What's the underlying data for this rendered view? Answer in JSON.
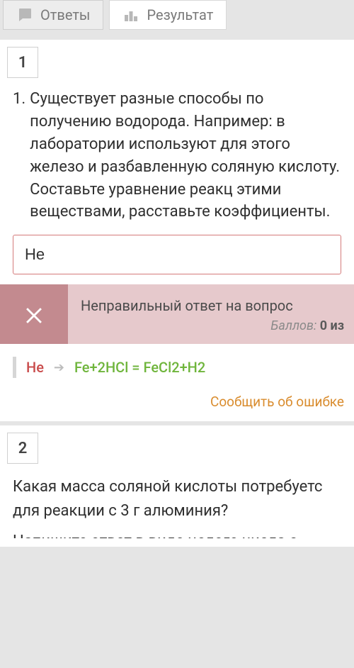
{
  "tabs": {
    "answers": "Ответы",
    "result": "Результат"
  },
  "q1": {
    "badge": "1",
    "list_num": "1.",
    "text": "Существует разные способы по получению водорода. Например: в лаборатории используют для этого железо и разбавленную соляную кислоту. Составьте уравнение реакц этими веществами, расставьте коэффициенты.",
    "user_input": "Не",
    "feedback_title": "Неправильный ответ на вопрос",
    "points_label": "Баллов:",
    "points_value": "0 из",
    "user_answer": "Не",
    "correct_answer": "Fe+2HCl = FeCl2+H2",
    "report": "Сообщить об ошибке"
  },
  "q2": {
    "badge": "2",
    "text": "Какая масса соляной кислоты потребуетс для реакции с 3 г алюминия?",
    "hint_cut": "Напишите ответ в виде целого числа с"
  }
}
